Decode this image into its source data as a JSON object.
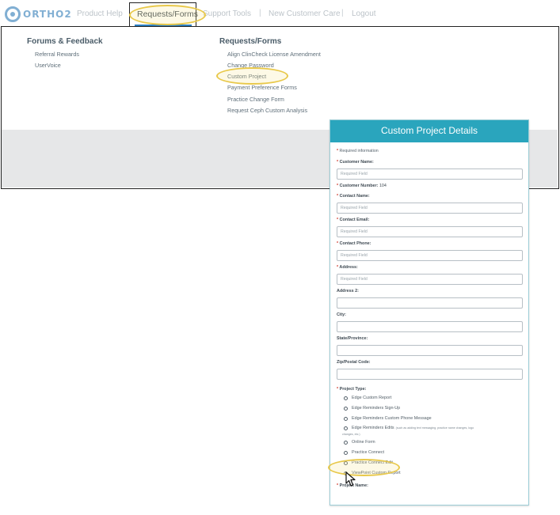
{
  "nav": {
    "logo_text": "ORTHO2",
    "items": [
      "Product Help",
      "Requests/Forms",
      "Support Tools",
      "New Customer Care",
      "Logout"
    ],
    "separator": "|",
    "active": "Requests/Forms"
  },
  "dropdown": {
    "left_column": {
      "title": "Forums & Feedback",
      "links": [
        "Referral Rewards",
        "UserVoice"
      ]
    },
    "right_column": {
      "title": "Requests/Forms",
      "links": [
        "Align ClinCheck License Amendment",
        "Change Password",
        "Custom Project",
        "Payment Preference Forms",
        "Practice Change Form",
        "Request Ceph Custom Analysis"
      ]
    }
  },
  "form": {
    "title": "Custom Project Details",
    "required_note": "Required information",
    "required_mark": "*",
    "placeholder": "Required Field",
    "fields": {
      "customer_name": "Customer Name:",
      "customer_number_label": "Customer Number:",
      "customer_number_value": "104",
      "contact_name": "Contact Name:",
      "contact_email": "Contact Email:",
      "contact_phone": "Contact Phone:",
      "address": "Address:",
      "address2": "Address 2:",
      "city": "City:",
      "state": "State/Province:",
      "zip": "Zip/Postal Code:",
      "project_type": "Project Type:",
      "project_name": "Project Name:"
    },
    "project_types": [
      "Edge Custom Report",
      "Edge Reminders Sign-Up",
      "Edge Reminders Custom Phone Message",
      "Edge Reminders Edits",
      "Online Form",
      "Practice Connect",
      "Practice Connect Edit",
      "ViewPoint Custom Report"
    ],
    "edits_note": "(such as adding text messaging, practice name changes, logo",
    "edits_note_cont": "changes, etc.)"
  },
  "colors": {
    "header_teal": "#2aa5bd",
    "highlight": "#e8c84a",
    "required_star": "#d23a2e",
    "nav_underline": "#2b7fc1"
  }
}
